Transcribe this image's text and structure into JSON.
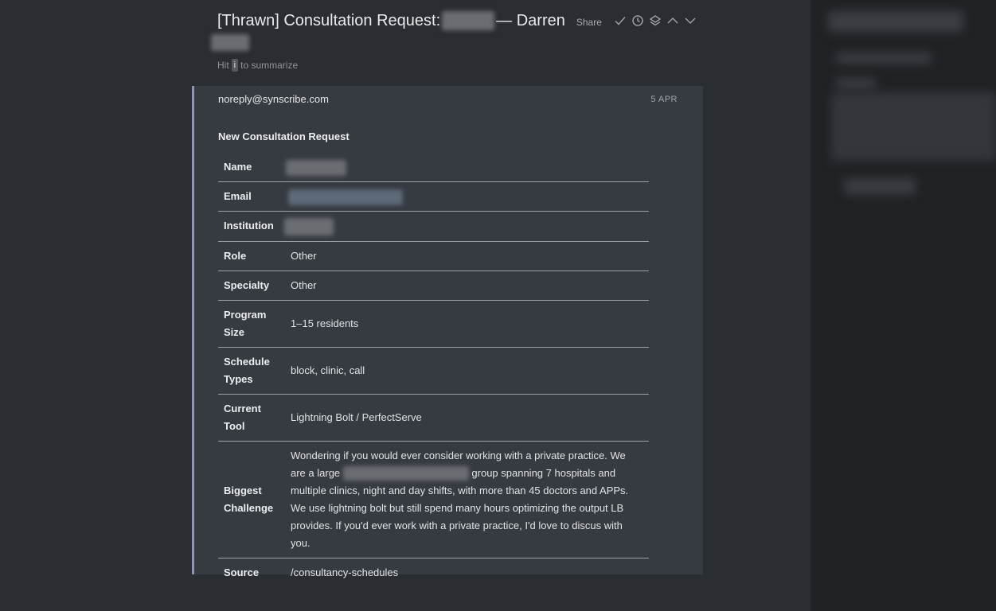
{
  "subject": {
    "prefix": "[Thrawn] Consultation Request:",
    "suffix": "— Darren",
    "share_label": "Share"
  },
  "icons": [
    "check-icon",
    "clock-icon",
    "layers-icon",
    "chevron-up-icon",
    "chevron-down-icon"
  ],
  "hint": {
    "before": "Hit",
    "key": "i",
    "after": "to summarize"
  },
  "email": {
    "sender": "noreply@synscribe.com",
    "date": "5 APR",
    "heading": "New Consultation Request",
    "fields": {
      "name_label": "Name",
      "email_label": "Email",
      "institution_label": "Institution",
      "role_label": "Role",
      "role_value": "Other",
      "specialty_label": "Specialty",
      "specialty_value": "Other",
      "program_size_label": "Program Size",
      "program_size_value": "1–15 residents",
      "schedule_types_label": "Schedule Types",
      "schedule_types_value": "block, clinic, call",
      "current_tool_label": "Current Tool",
      "current_tool_value": "Lightning Bolt / PerfectServe",
      "biggest_challenge_label": "Biggest Challenge",
      "biggest_challenge_before": "Wondering if you would ever consider working with a private practice. We are a large",
      "biggest_challenge_after": "group spanning 7 hospitals and multiple clinics, night and day shifts, with more than 45 doctors and APPs. We use lightning bolt but still spend many hours optimizing the output LB provides. If you'd ever work with a private practice, I'd love to discus with you.",
      "source_label": "Source",
      "source_value": "/consultancy-schedules"
    }
  },
  "colors": {
    "background": "#2a2d31",
    "card": "#363a41",
    "accent_border": "#8b93bd",
    "sidebar": "#202225"
  }
}
